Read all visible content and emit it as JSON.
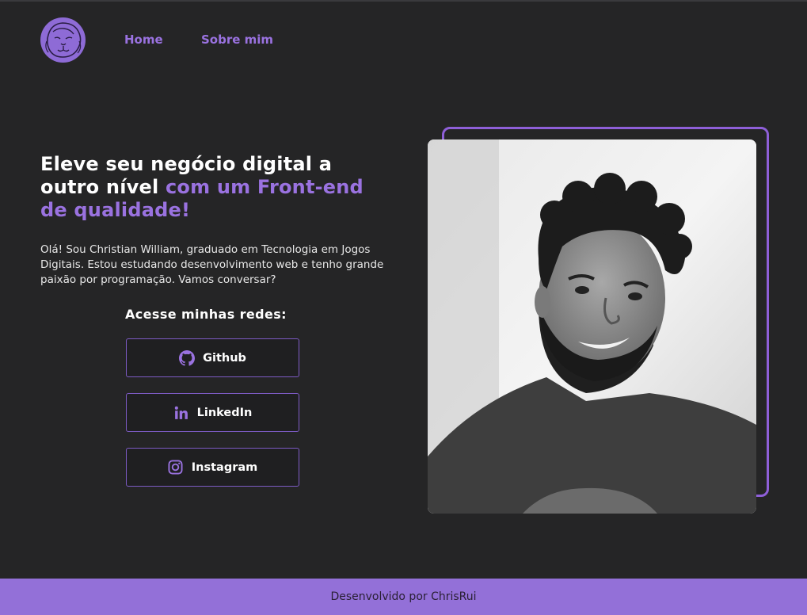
{
  "header": {
    "logo_icon": "lion-logo-icon",
    "nav": [
      {
        "label": "Home"
      },
      {
        "label": "Sobre mim"
      }
    ]
  },
  "hero": {
    "headline_plain": "Eleve seu negócio digital a outro nível ",
    "headline_accent": "com um Front-end de qualidade!",
    "bio": "Olá! Sou Christian William, graduado em Tecnologia em Jogos Digitais. Estou estudando desenvolvimento web e tenho grande paixão por programação. Vamos conversar?",
    "social_title": "Acesse minhas redes:",
    "social": [
      {
        "label": "Github",
        "icon": "github-icon"
      },
      {
        "label": "LinkedIn",
        "icon": "linkedin-icon"
      },
      {
        "label": "Instagram",
        "icon": "instagram-icon"
      }
    ]
  },
  "footer": {
    "text": "Desenvolvido por ChrisRui"
  },
  "colors": {
    "background": "#252526",
    "accent": "#9a72e0",
    "footer": "#9370d8"
  }
}
